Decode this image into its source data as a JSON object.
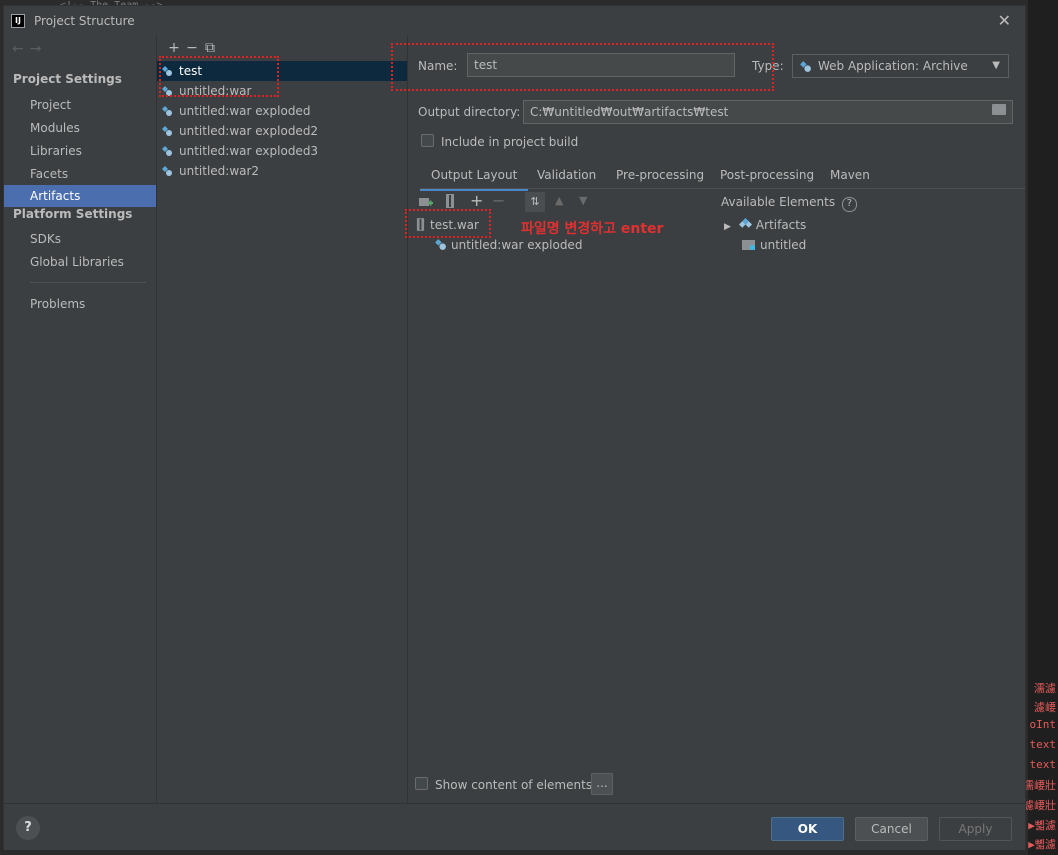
{
  "window": {
    "title": "Project Structure"
  },
  "background": {
    "top_code": "<!-- The Team -->",
    "right_strip": [
      "濡濾",
      "濾崾",
      "oInt",
      "text",
      "text",
      "濡崾壯",
      "濾崾壯",
      "▶뼯濾",
      "▶뼯濾"
    ]
  },
  "nav": {
    "project_settings_header": "Project Settings",
    "project_items": [
      {
        "label": "Project"
      },
      {
        "label": "Modules"
      },
      {
        "label": "Libraries"
      },
      {
        "label": "Facets"
      },
      {
        "label": "Artifacts"
      }
    ],
    "platform_settings_header": "Platform Settings",
    "platform_items": [
      {
        "label": "SDKs"
      },
      {
        "label": "Global Libraries"
      }
    ],
    "problems_label": "Problems"
  },
  "artifacts": {
    "toolbar": {
      "add": "+",
      "remove": "−",
      "copy": "⧉"
    },
    "items": [
      {
        "label": "test"
      },
      {
        "label": "untitled:war"
      },
      {
        "label": "untitled:war exploded"
      },
      {
        "label": "untitled:war exploded2"
      },
      {
        "label": "untitled:war exploded3"
      },
      {
        "label": "untitled:war2"
      }
    ]
  },
  "form": {
    "name_label": "Name:",
    "name_value": "test",
    "type_label": "Type:",
    "type_value": "Web Application: Archive",
    "output_dir_label": "Output directory:",
    "output_dir_value": "C:₩untitled₩out₩artifacts₩test",
    "include_build_label": "Include in project build"
  },
  "tabs": [
    {
      "label": "Output Layout"
    },
    {
      "label": "Validation"
    },
    {
      "label": "Pre-processing"
    },
    {
      "label": "Post-processing"
    },
    {
      "label": "Maven"
    }
  ],
  "layout_toolbar": {
    "add": "+",
    "remove": "−"
  },
  "layout_tree": {
    "root": "test.war",
    "child": "untitled:war exploded",
    "annotation": "파일명 변경하고 enter"
  },
  "available": {
    "label": "Available Elements",
    "help_glyph": "?",
    "items": [
      {
        "label": "Artifacts"
      },
      {
        "label": "untitled"
      }
    ]
  },
  "show_content": {
    "label": "Show content of elements",
    "button": "..."
  },
  "footer": {
    "help": "?",
    "ok": "OK",
    "cancel": "Cancel",
    "apply": "Apply"
  },
  "colors": {
    "dialog_bg": "#3c3f41",
    "selection_nav": "#4b6eaf",
    "selection_artifact": "#0d293e",
    "annotation_red": "#e03030",
    "primary_button": "#365880"
  }
}
